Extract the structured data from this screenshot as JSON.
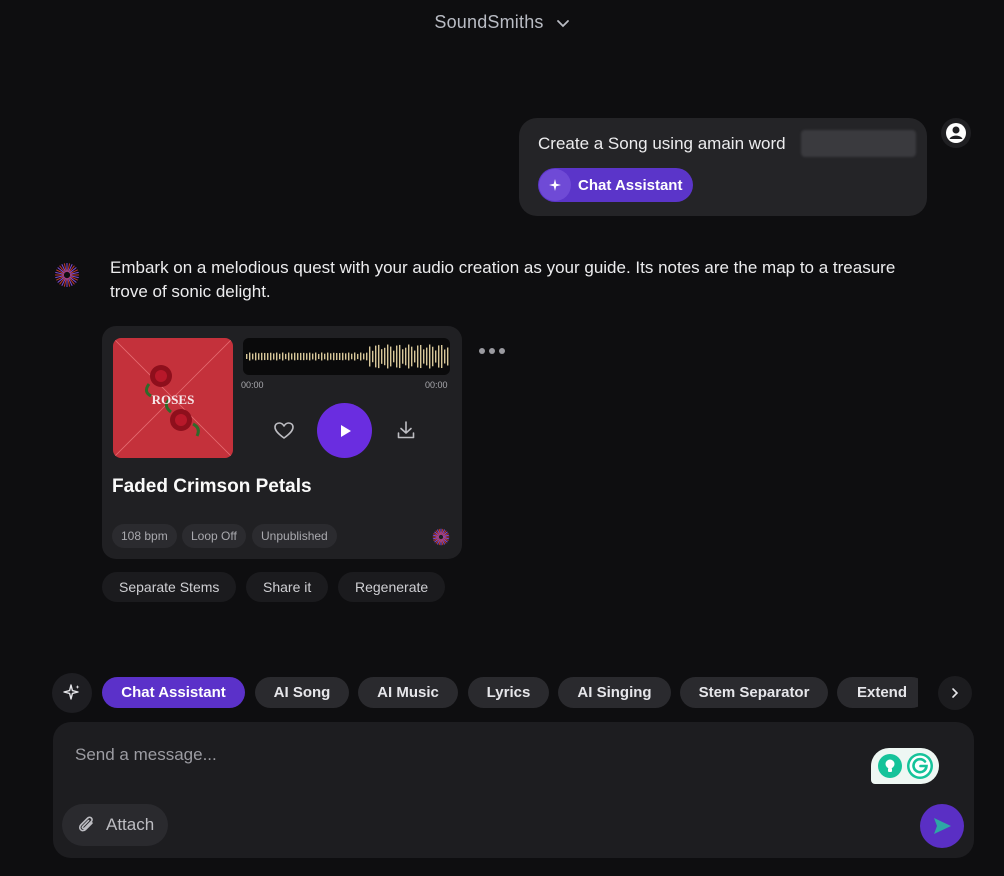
{
  "header": {
    "title": "SoundSmiths",
    "chevron_icon": "chevron-down-icon"
  },
  "user_message": {
    "text": "Create a Song using amain word",
    "mode_chip": "Chat Assistant",
    "avatar_icon": "user-icon"
  },
  "bot_message": {
    "text": "Embark on a melodious quest with your audio creation as your guide. Its notes are the map to a treasure trove of sonic delight."
  },
  "song": {
    "title": "Faded Crimson Petals",
    "time_start": "00:00",
    "time_end": "00:00",
    "tags": [
      "108 bpm",
      "Loop Off",
      "Unpublished"
    ],
    "cover_text": "ROSES",
    "accent_color": "#6a2de0"
  },
  "actions": [
    "Separate Stems",
    "Share it",
    "Regenerate"
  ],
  "tools": {
    "items": [
      "Chat Assistant",
      "AI Song",
      "AI Music",
      "Lyrics",
      "AI Singing",
      "Stem Separator",
      "Extend"
    ],
    "active": "Chat Assistant"
  },
  "composer": {
    "placeholder": "Send a message...",
    "attach_label": "Attach"
  }
}
